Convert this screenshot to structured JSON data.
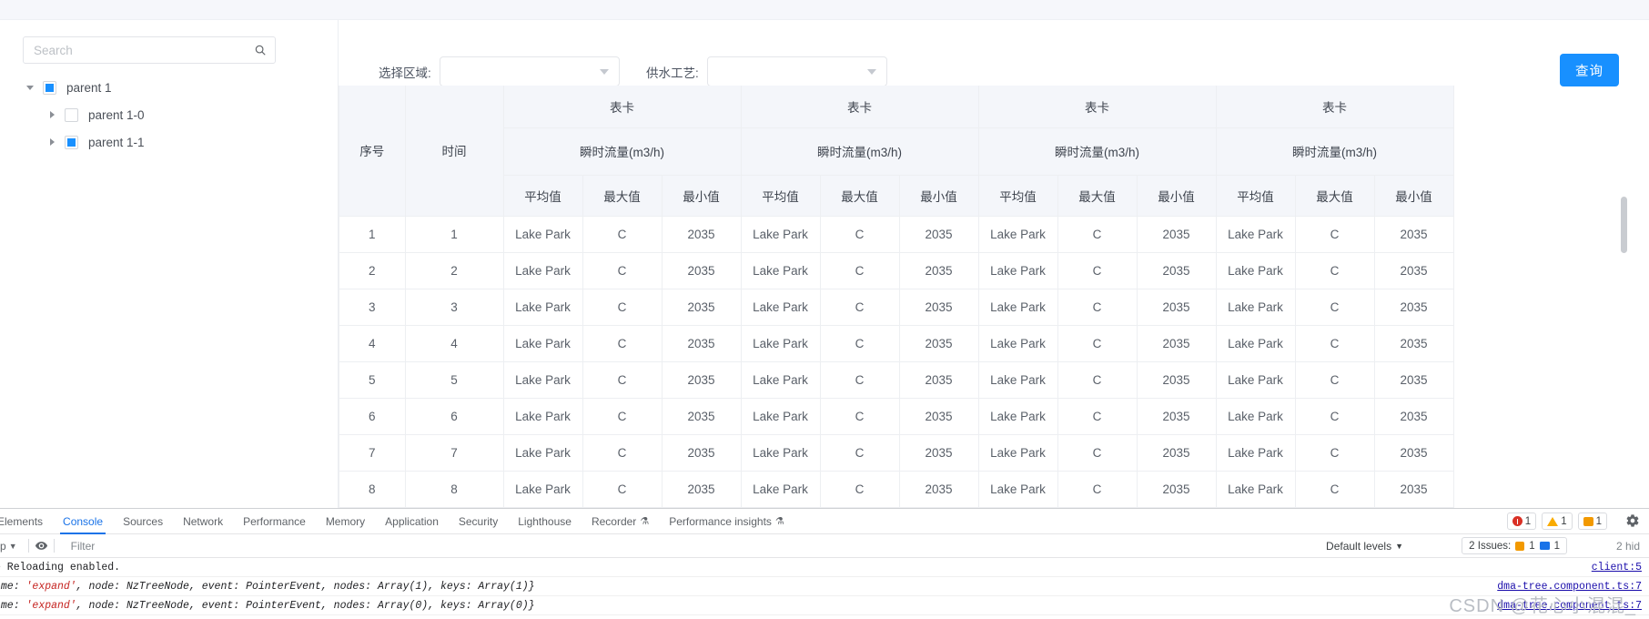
{
  "sidebar": {
    "search": {
      "placeholder": "Search",
      "value": "",
      "icon": "search-icon"
    },
    "tree": [
      {
        "label": "parent 1",
        "level": 0,
        "expanded": true,
        "checked": "filled",
        "caret": "down"
      },
      {
        "label": "parent 1-0",
        "level": 1,
        "expanded": false,
        "checked": "unchecked",
        "caret": "right"
      },
      {
        "label": "parent 1-1",
        "level": 1,
        "expanded": false,
        "checked": "filled",
        "caret": "right"
      }
    ]
  },
  "filters": {
    "region": {
      "label": "选择区域:",
      "value": "",
      "placeholder": ""
    },
    "process": {
      "label": "供水工艺:",
      "value": "",
      "placeholder": ""
    },
    "query_button": "查询",
    "accent_color": "#1890ff"
  },
  "table": {
    "header_row1": {
      "seq": "序号",
      "time": "时间",
      "groups": [
        "表卡",
        "表卡",
        "表卡",
        "表卡"
      ]
    },
    "header_row2": [
      "瞬时流量(m3/h)",
      "瞬时流量(m3/h)",
      "瞬时流量(m3/h)",
      "瞬时流量(m3/h)"
    ],
    "header_row3": [
      "平均值",
      "最大值",
      "最小值",
      "平均值",
      "最大值",
      "最小值",
      "平均值",
      "最大值",
      "最小值",
      "平均值",
      "最大值",
      "最小值"
    ],
    "rows": [
      {
        "seq": "1",
        "time": "1",
        "cells": [
          "Lake Park",
          "C",
          "2035",
          "Lake Park",
          "C",
          "2035",
          "Lake Park",
          "C",
          "2035",
          "Lake Park",
          "C",
          "2035"
        ]
      },
      {
        "seq": "2",
        "time": "2",
        "cells": [
          "Lake Park",
          "C",
          "2035",
          "Lake Park",
          "C",
          "2035",
          "Lake Park",
          "C",
          "2035",
          "Lake Park",
          "C",
          "2035"
        ]
      },
      {
        "seq": "3",
        "time": "3",
        "cells": [
          "Lake Park",
          "C",
          "2035",
          "Lake Park",
          "C",
          "2035",
          "Lake Park",
          "C",
          "2035",
          "Lake Park",
          "C",
          "2035"
        ]
      },
      {
        "seq": "4",
        "time": "4",
        "cells": [
          "Lake Park",
          "C",
          "2035",
          "Lake Park",
          "C",
          "2035",
          "Lake Park",
          "C",
          "2035",
          "Lake Park",
          "C",
          "2035"
        ]
      },
      {
        "seq": "5",
        "time": "5",
        "cells": [
          "Lake Park",
          "C",
          "2035",
          "Lake Park",
          "C",
          "2035",
          "Lake Park",
          "C",
          "2035",
          "Lake Park",
          "C",
          "2035"
        ]
      },
      {
        "seq": "6",
        "time": "6",
        "cells": [
          "Lake Park",
          "C",
          "2035",
          "Lake Park",
          "C",
          "2035",
          "Lake Park",
          "C",
          "2035",
          "Lake Park",
          "C",
          "2035"
        ]
      },
      {
        "seq": "7",
        "time": "7",
        "cells": [
          "Lake Park",
          "C",
          "2035",
          "Lake Park",
          "C",
          "2035",
          "Lake Park",
          "C",
          "2035",
          "Lake Park",
          "C",
          "2035"
        ]
      },
      {
        "seq": "8",
        "time": "8",
        "cells": [
          "Lake Park",
          "C",
          "2035",
          "Lake Park",
          "C",
          "2035",
          "Lake Park",
          "C",
          "2035",
          "Lake Park",
          "C",
          "2035"
        ]
      }
    ]
  },
  "devtools": {
    "tabs": [
      {
        "label": "Elements",
        "active": false
      },
      {
        "label": "Console",
        "active": true
      },
      {
        "label": "Sources",
        "active": false
      },
      {
        "label": "Network",
        "active": false
      },
      {
        "label": "Performance",
        "active": false
      },
      {
        "label": "Memory",
        "active": false
      },
      {
        "label": "Application",
        "active": false
      },
      {
        "label": "Security",
        "active": false
      },
      {
        "label": "Lighthouse",
        "active": false
      },
      {
        "label": "Recorder",
        "active": false
      },
      {
        "label": "Performance insights",
        "active": false
      }
    ],
    "counts": {
      "errors": "1",
      "warnings": "1",
      "infos": "1"
    },
    "toolbar": {
      "context": "p",
      "filter_placeholder": "Filter",
      "filter_value": "",
      "levels": "Default levels",
      "issues_label": "2 Issues:",
      "issues_yellow": "1",
      "issues_blue": "1",
      "hidden": "2 hid"
    },
    "logs": [
      {
        "text": "e Reloading enabled.",
        "source": "client:5",
        "mono": true
      },
      {
        "pre": "ame: ",
        "str": "'expand'",
        "post": ", node: NzTreeNode, event: PointerEvent, nodes: Array(1), keys: Array(1)}",
        "source": "dma-tree.component.ts:7"
      },
      {
        "pre": "ame: ",
        "str": "'expand'",
        "post": ", node: NzTreeNode, event: PointerEvent, nodes: Array(0), keys: Array(0)}",
        "source": "dma-tree.component.ts:7"
      }
    ]
  },
  "watermark": "CSDN @花心小混混_"
}
